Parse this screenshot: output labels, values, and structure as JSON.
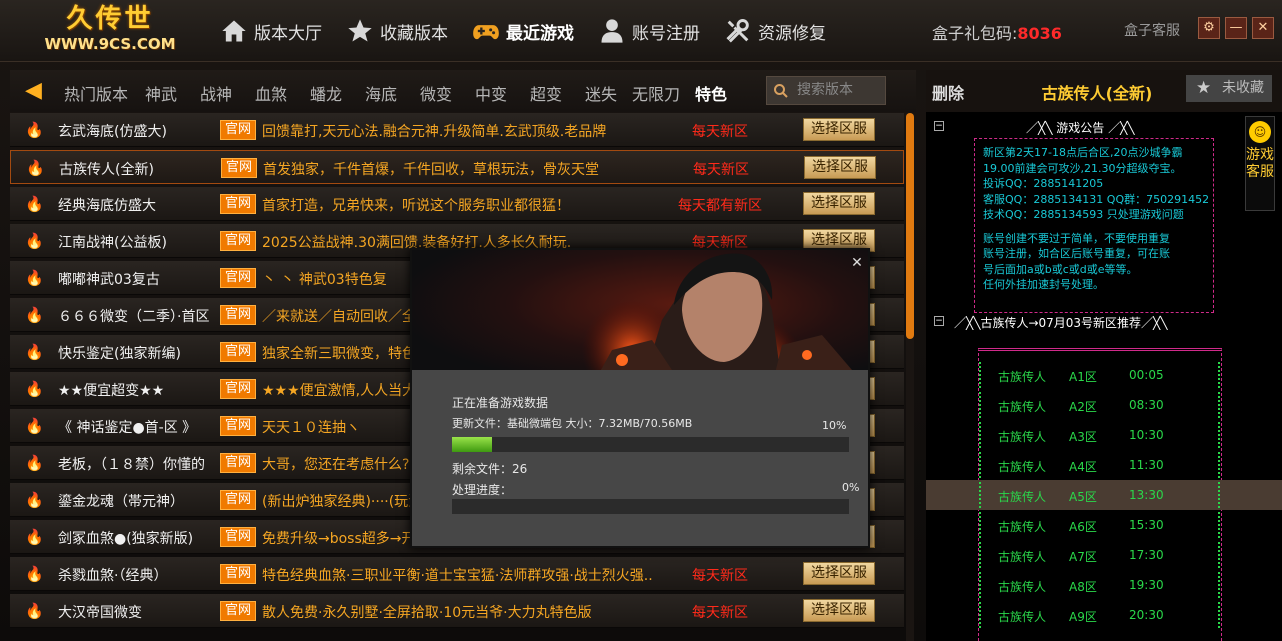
{
  "header": {
    "logo_title": "久传世",
    "logo_url": "WWW.9CS.COM",
    "nav": [
      {
        "label": "版本大厅",
        "icon": "home-icon"
      },
      {
        "label": "收藏版本",
        "icon": "star-icon"
      },
      {
        "label": "最近游戏",
        "icon": "gamepad-icon",
        "active": true
      },
      {
        "label": "账号注册",
        "icon": "user-icon"
      },
      {
        "label": "资源修复",
        "icon": "wrench-icon"
      }
    ],
    "gift_label": "盒子礼包码:",
    "gift_code": "8036",
    "service": "盒子客服",
    "accent_color": "#ffcc33",
    "gift_code_color": "#ff2a2a"
  },
  "categories": {
    "items": [
      "热门版本",
      "神武",
      "战神",
      "血煞",
      "蟠龙",
      "海底",
      "微变",
      "中变",
      "超变",
      "迷失",
      "无限刀",
      "特色"
    ],
    "active": "特色",
    "search_placeholder": "搜索版本"
  },
  "list": {
    "official_label": "官网",
    "select_label": "选择区服",
    "rows": [
      {
        "name": "玄武海底(仿盛大)",
        "desc": "回馈靠打,天元心法.融合元神.升级简单.玄武顶级.老品牌",
        "daily": "每天新区"
      },
      {
        "name": "古族传人(全新)",
        "desc": "首发独家，千件首爆，千件回收，草根玩法，骨灰天堂",
        "daily": "每天新区",
        "selected": true
      },
      {
        "name": "经典海底仿盛大",
        "desc": "首家打造，兄弟快来，听说这个服务职业都很猛！",
        "daily": "每天都有新区"
      },
      {
        "name": "江南战神(公益板)",
        "desc": "2025公益战神.30满回馈.装备好打.人多长久耐玩.",
        "daily": "每天新区"
      },
      {
        "name": "嘟嘟神武03复古",
        "desc": "丶 丶  神武03特色复",
        "daily": ""
      },
      {
        "name": "６６６微变（二季）·首区",
        "desc": "／来就送／自动回收／全",
        "daily": ""
      },
      {
        "name": "快乐鉴定(独家新编)",
        "desc": "独家全新三职微变，特色",
        "daily": ""
      },
      {
        "name": "★★便宜超变★★",
        "desc": "★★★便宜激情,人人当大",
        "daily": ""
      },
      {
        "name": "《  神话鉴定●首-区  》",
        "desc": "天天１０连抽ヽ",
        "daily": ""
      },
      {
        "name": "老板，（１８禁）你懂的",
        "desc": "大哥，您还在考虑什么?",
        "daily": ""
      },
      {
        "name": "鎏金龙魂（帯元神）",
        "desc": "(新出炉独家经典)····(玩法",
        "daily": ""
      },
      {
        "name": "剑冢血煞●(独家新版)",
        "desc": "免费升级→boss超多→开",
        "daily": ""
      },
      {
        "name": "杀戮血煞·（经典）",
        "desc": "特色经典血煞·三职业平衡·道士宝宝猛·法师群攻强·战士烈火强..",
        "daily": "每天新区"
      },
      {
        "name": "大汉帝国微变",
        "desc": "散人免费·永久别墅·全屏拾取·10元当爷·大力丸特色版",
        "daily": "每天新区"
      }
    ]
  },
  "right": {
    "delete": "删除",
    "title": "古族传人(全新)",
    "unfav": "未收藏",
    "notice_title": "／╳╲ 游戏公告 ／╳╲",
    "notice_lines": [
      "新区第2天17-18点后合区,20点沙城争霸",
      "19.00前建会可攻沙,21.30分超级夺宝。",
      "    投诉QQ：2885141205",
      "客服QQ：2885134131 QQ群：750291452",
      "技术QQ：2885134593 只处理游戏问题"
    ],
    "notice_lines2": [
      "账号创建不要过于简单，不要使用重复",
      "账号注册，如合区后账号重复，可在账",
      "号后面加a或b或c或d或e等等。",
      "任何外挂加速封号处理。"
    ],
    "rec_title": "／╳╲古族传人→07月03号新区推荐／╳╲",
    "servers": [
      {
        "name": "古族传人",
        "zone": "A1区",
        "time": "00:05"
      },
      {
        "name": "古族传人",
        "zone": "A2区",
        "time": "08:30"
      },
      {
        "name": "古族传人",
        "zone": "A3区",
        "time": "10:30"
      },
      {
        "name": "古族传人",
        "zone": "A4区",
        "time": "11:30"
      },
      {
        "name": "古族传人",
        "zone": "A5区",
        "time": "13:30",
        "highlight": true
      },
      {
        "name": "古族传人",
        "zone": "A6区",
        "time": "15:30"
      },
      {
        "name": "古族传人",
        "zone": "A7区",
        "time": "17:30"
      },
      {
        "name": "古族传人",
        "zone": "A8区",
        "time": "19:30"
      },
      {
        "name": "古族传人",
        "zone": "A9区",
        "time": "20:30"
      }
    ],
    "service_tab": "游戏客服"
  },
  "dialog": {
    "status": "正在准备游戏数据",
    "update_file": "更新文件：基础微端包 大小：7.32MB/70.56MB",
    "update_percent": "10%",
    "update_fraction": 0.1,
    "remaining": "剩余文件：26",
    "process_label": "处理进度：",
    "process_percent": "0%",
    "process_fraction": 0,
    "close": "✕"
  }
}
